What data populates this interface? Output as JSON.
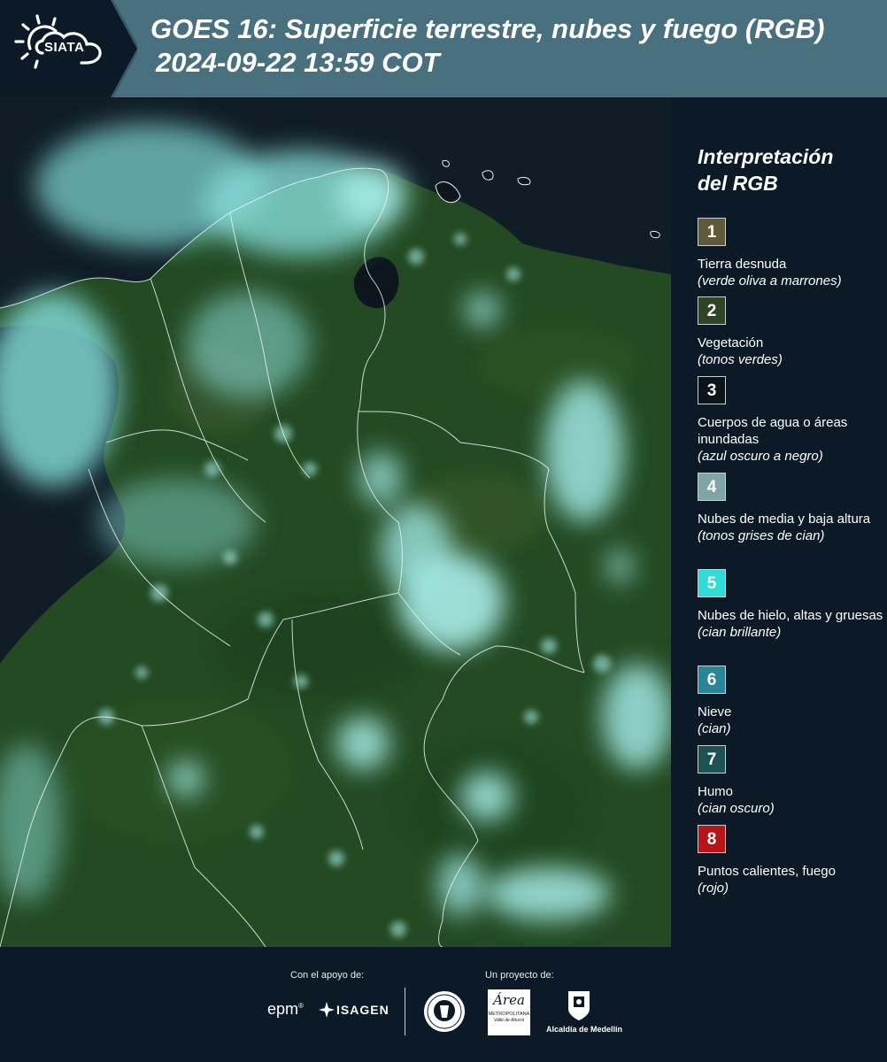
{
  "header": {
    "logo_text": "SIATA",
    "title_line1": "GOES 16: Superficie terrestre, nubes y fuego (RGB)",
    "title_line2": "2024-09-22 13:59 COT"
  },
  "legend": {
    "title_line1": "Interpretación",
    "title_line2": "del RGB",
    "items": [
      {
        "num": "1",
        "color": "#5f5a3a",
        "label": "Tierra desnuda",
        "desc": "(verde oliva a marrones)"
      },
      {
        "num": "2",
        "color": "#2e4424",
        "label": "Vegetación",
        "desc": "(tonos verdes)"
      },
      {
        "num": "3",
        "color": "#0c1418",
        "label": "Cuerpos de agua o áreas inundadas",
        "desc": "(azul oscuro a negro)"
      },
      {
        "num": "4",
        "color": "#7fa5a6",
        "label": "Nubes de media y baja altura",
        "desc": "(tonos grises de cian)"
      },
      {
        "num": "5",
        "color": "#2fdcd8",
        "label": "Nubes de hielo, altas y gruesas",
        "desc": "(cian brillante)"
      },
      {
        "num": "6",
        "color": "#2a8598",
        "label": "Nieve",
        "desc": "(cian)"
      },
      {
        "num": "7",
        "color": "#1d5154",
        "label": "Humo",
        "desc": "(cian oscuro)"
      },
      {
        "num": "8",
        "color": "#b8151b",
        "label": "Puntos calientes, fuego",
        "desc": "(rojo)"
      }
    ]
  },
  "footer": {
    "support_label": "Con el apoyo de:",
    "project_label": "Un proyecto de:",
    "epm": "epm",
    "isagen": "ISAGEN",
    "area_word": "Área",
    "area_sub1": "METROPOLITANA",
    "area_sub2": "Valle de Aburrá",
    "alcaldia": "Alcaldía de Medellín"
  },
  "colors": {
    "header_bg": "#48707e",
    "page_bg": "#0b1a26",
    "ocean": "#0f1d27",
    "land": "#244a23",
    "cloud": "#8ee4e0",
    "border_lines": "#e8f0f2"
  }
}
